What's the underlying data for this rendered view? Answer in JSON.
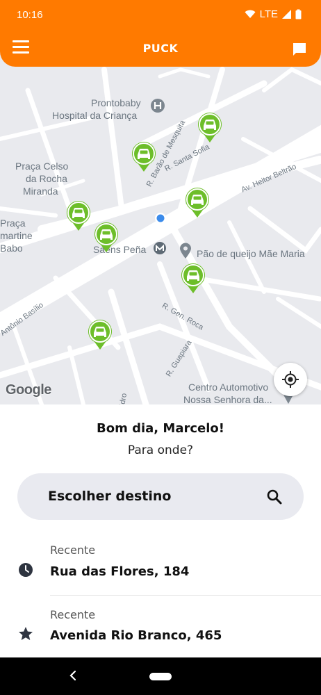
{
  "status_bar": {
    "time": "10:16",
    "network": "LTE"
  },
  "header": {
    "title": "PUCK",
    "menu_icon": "hamburger-menu-icon",
    "chat_icon": "chat-bubble-icon"
  },
  "map": {
    "places": [
      {
        "name": "Prontobaby",
        "kind": "hospital"
      },
      {
        "name": "Hospital da Criança",
        "kind": "hospital"
      },
      {
        "name": "Praça Celso",
        "kind": "square"
      },
      {
        "name": "da Rocha",
        "kind": "square"
      },
      {
        "name": "Miranda",
        "kind": "square"
      },
      {
        "name": "Praça",
        "kind": "square"
      },
      {
        "name": "martine",
        "kind": "square"
      },
      {
        "name": "Babo",
        "kind": "square"
      },
      {
        "name": "Saens Peña",
        "kind": "metro"
      },
      {
        "name": "Pão de queijo Mãe Maria",
        "kind": "poi"
      },
      {
        "name": "Centro Automotivo",
        "kind": "poi"
      },
      {
        "name": "Nossa Senhora da...",
        "kind": "poi"
      }
    ],
    "streets": [
      "R. Barão de Mesquita",
      "R. Santa Sofia",
      "Av. Heitor Beltrão",
      "R. Gen. Roca",
      "R. Guapiara",
      "Antônio Basílio",
      "idro"
    ],
    "car_count": 7,
    "google_logo": "Google",
    "locate_icon": "my-location-icon"
  },
  "sheet": {
    "greeting": "Bom dia, Marcelo!",
    "question": "Para onde?",
    "search_label": "Escolher destino",
    "recents": [
      {
        "icon": "clock-icon",
        "label": "Recente",
        "address": "Rua das Flores, 184"
      },
      {
        "icon": "star-icon",
        "label": "Recente",
        "address": "Avenida Rio Branco, 465"
      }
    ]
  },
  "colors": {
    "brand": "#FF7A00",
    "car_pin": "#6DBE2A",
    "map_bg": "#E9EAEE",
    "road": "#FFFFFF"
  }
}
